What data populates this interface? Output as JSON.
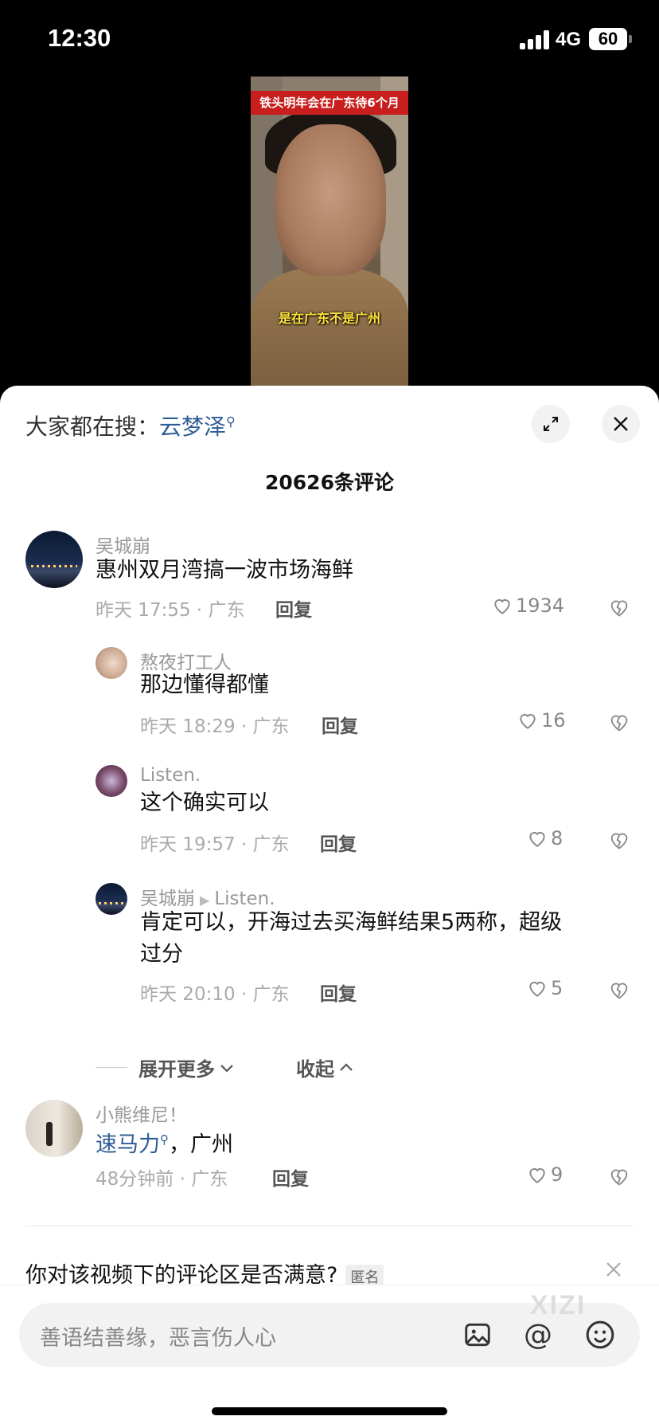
{
  "status": {
    "time": "12:30",
    "network": "4G",
    "battery": "60"
  },
  "video": {
    "title": "铁头明年会在广东待6个月",
    "subtitle": "是在广东不是广州"
  },
  "sheet": {
    "search_prefix": "大家都在搜：",
    "search_keyword": "云梦泽",
    "comment_count": "20626条评论"
  },
  "comments": [
    {
      "user": "吴城崩",
      "text": "惠州双月湾搞一波市场海鲜",
      "meta": "昨天 17:55 · 广东",
      "reply": "回复",
      "likes": "1934"
    },
    {
      "user": "熬夜打工人",
      "text": "那边懂得都懂",
      "meta": "昨天 18:29 · 广东",
      "reply": "回复",
      "likes": "16"
    },
    {
      "user": "Listen.",
      "text": "这个确实可以",
      "meta": "昨天 19:57 · 广东",
      "reply": "回复",
      "likes": "8"
    },
    {
      "user": "吴城崩",
      "reply_to": "Listen.",
      "text_line1": "肯定可以，开海过去买海鲜结果5两称，超级",
      "text_line2": "过分",
      "meta": "昨天 20:10 · 广东",
      "reply": "回复",
      "likes": "5"
    },
    {
      "user": "小熊维尼！",
      "text_link": "速马力",
      "text_rest": "，广州",
      "meta": "48分钟前 · 广东",
      "reply": "回复",
      "likes": "9"
    }
  ],
  "thread": {
    "expand_more": "展开更多",
    "collapse": "收起"
  },
  "survey": {
    "question": "你对该视频下的评论区是否满意?",
    "tag": "匿名"
  },
  "input": {
    "placeholder": "善语结善缘，恶言伤人心",
    "watermark": "XIZI"
  }
}
